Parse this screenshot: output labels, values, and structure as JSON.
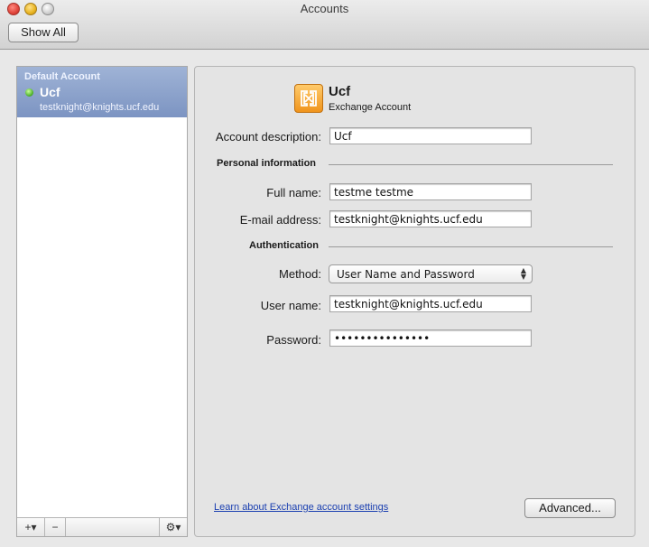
{
  "window": {
    "title": "Accounts"
  },
  "toolbar": {
    "show_all_label": "Show All"
  },
  "sidebar": {
    "group_label": "Default Account",
    "accounts": [
      {
        "name": "Ucf",
        "email": "testknight@knights.ucf.edu",
        "status_color": "#4cb02a"
      }
    ],
    "footer": {
      "add_label": "+▾",
      "remove_label": "−",
      "gear_label": "⚙▾"
    }
  },
  "account": {
    "title": "Ucf",
    "type": "Exchange Account",
    "icon": "exchange-icon",
    "description_label": "Account description:",
    "description_value": "Ucf",
    "personal_info_heading": "Personal information",
    "full_name_label": "Full name:",
    "full_name_value": "testme testme",
    "email_label": "E-mail address:",
    "email_value": "testknight@knights.ucf.edu",
    "auth_heading": "Authentication",
    "method_label": "Method:",
    "method_value": "User Name and Password",
    "username_label": "User name:",
    "username_value": "testknight@knights.ucf.edu",
    "password_label": "Password:",
    "password_value": "•••••••••••••••"
  },
  "footer": {
    "learn_link": "Learn about Exchange account settings",
    "advanced_label": "Advanced..."
  },
  "colors": {
    "selection": "#8ca2cc",
    "link": "#1a3fb0"
  }
}
